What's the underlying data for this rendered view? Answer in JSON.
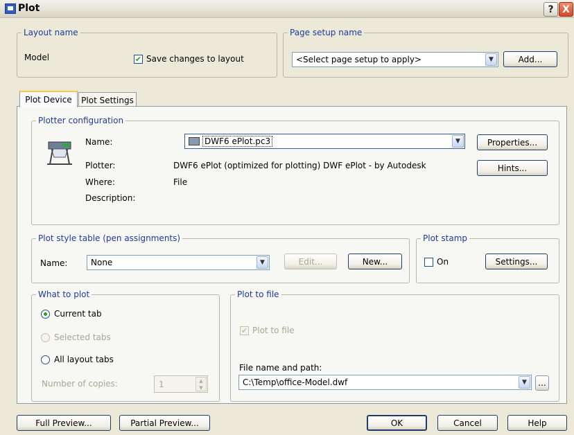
{
  "window": {
    "title": "Plot",
    "help_glyph": "?",
    "close_glyph": "X"
  },
  "layout_name": {
    "legend": "Layout name",
    "value": "Model",
    "save_checkbox_label": "Save changes to layout",
    "save_checked": true
  },
  "page_setup": {
    "legend": "Page setup name",
    "select_value": "<Select page setup to apply>",
    "add_button": "Add..."
  },
  "tabs": [
    {
      "label": "Plot Device",
      "active": true
    },
    {
      "label": "Plot Settings",
      "active": false
    }
  ],
  "plotter": {
    "legend": "Plotter configuration",
    "name_label": "Name:",
    "name_value": "DWF6 ePlot.pc3",
    "plotter_label": "Plotter:",
    "plotter_value": "DWF6 ePlot (optimized for plotting) DWF ePlot - by Autodesk",
    "where_label": "Where:",
    "where_value": "File",
    "description_label": "Description:",
    "properties_button": "Properties...",
    "hints_button": "Hints..."
  },
  "plot_style": {
    "legend": "Plot style table (pen assignments)",
    "name_label": "Name:",
    "value": "None",
    "edit_button": "Edit...",
    "new_button": "New..."
  },
  "plot_stamp": {
    "legend": "Plot stamp",
    "on_label": "On",
    "on_checked": false,
    "settings_button": "Settings..."
  },
  "what_to_plot": {
    "legend": "What to plot",
    "current_tab": "Current tab",
    "selected_tabs": "Selected tabs",
    "all_layout_tabs": "All layout tabs",
    "selected_option": "current_tab",
    "copies_label": "Number of copies:",
    "copies_value": "1"
  },
  "plot_to_file": {
    "legend": "Plot to file",
    "checkbox_label": "Plot to file",
    "checked": true,
    "path_label": "File name and path:",
    "path_value": "C:\\Temp\\office-Model.dwf",
    "browse_button": "..."
  },
  "footer": {
    "full_preview": "Full Preview...",
    "partial_preview": "Partial Preview...",
    "ok": "OK",
    "cancel": "Cancel",
    "help": "Help"
  }
}
